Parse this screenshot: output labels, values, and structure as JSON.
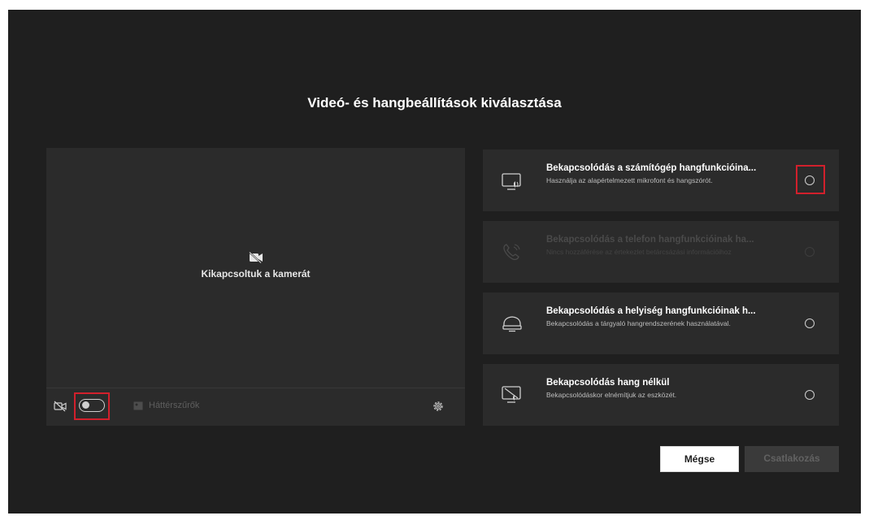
{
  "dialog": {
    "title": "Videó- és hangbeállítások kiválasztása"
  },
  "preview": {
    "camera_off_label": "Kikapcsoltuk a kamerát",
    "camera_off_icon": "video-off-icon",
    "background_filters_label": "Háttérszűrők",
    "camera_toggle_state": "off",
    "settings_icon": "gear-icon"
  },
  "audio_options": [
    {
      "title": "Bekapcsolódás a számítógép hangfunkcióina...",
      "description": "Használja az alapértelmezett mikrofont és hangszórót.",
      "icon": "computer-audio-icon",
      "enabled": true,
      "selected": false
    },
    {
      "title": "Bekapcsolódás a telefon hangfunkcióinak ha...",
      "description": "Nincs hozzáférése az értekezlet betárcsázási információihoz",
      "icon": "phone-icon",
      "enabled": false,
      "selected": false
    },
    {
      "title": "Bekapcsolódás a helyiség hangfunkcióinak h...",
      "description": "Bekapcsolódás a tárgyaló hangrendszerének használatával.",
      "icon": "room-audio-icon",
      "enabled": true,
      "selected": false
    },
    {
      "title": "Bekapcsolódás hang nélkül",
      "description": "Bekapcsolódáskor elnémítjuk az eszközét.",
      "icon": "no-audio-icon",
      "enabled": true,
      "selected": false
    }
  ],
  "buttons": {
    "cancel_label": "Mégse",
    "join_label": "Csatlakozás"
  },
  "colors": {
    "background": "#1f1f1f",
    "panel": "#2b2b2b",
    "highlight": "#d2202c",
    "text": "#ffffff"
  }
}
